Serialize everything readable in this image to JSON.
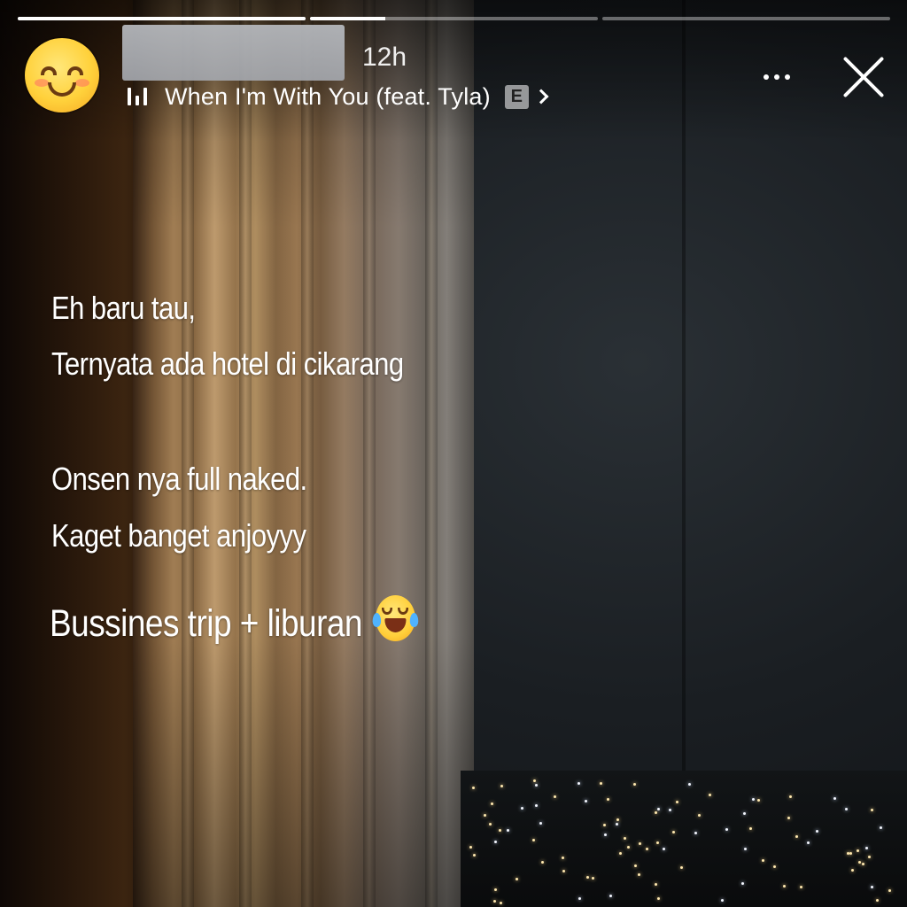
{
  "story": {
    "progress": [
      {
        "fill": 1.0
      },
      {
        "fill": 0.26
      },
      {
        "fill": 0.0
      }
    ],
    "time_ago": "12h",
    "music": {
      "song": "When I'm With You (feat. Tyla)",
      "explicit_badge": "E",
      "icon": "equalizer-icon"
    },
    "caption": {
      "line1": "Eh baru tau,",
      "line2": "Ternyata ada hotel di cikarang",
      "line3": "Onsen nya full naked.",
      "line4": "Kaget banget anjoyyy",
      "line5": "Bussines trip + liburan"
    },
    "icons": {
      "avatar": "smiling-face-emoji",
      "more": "more-horizontal-icon",
      "close": "close-icon",
      "caption_emoji": "tears-of-joy-emoji"
    }
  }
}
